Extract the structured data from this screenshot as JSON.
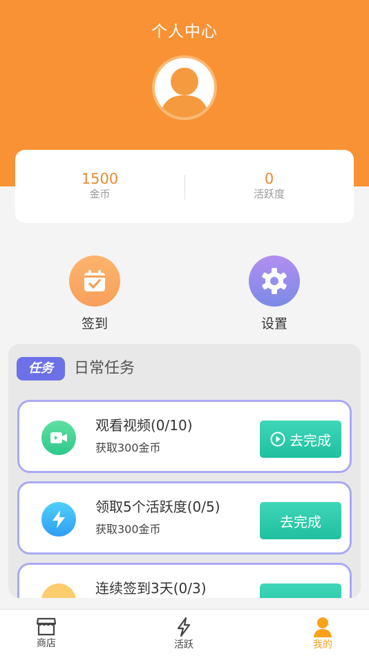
{
  "header": {
    "title": "个人中心"
  },
  "stats": [
    {
      "value": "1500",
      "label": "金币"
    },
    {
      "value": "0",
      "label": "活跃度"
    }
  ],
  "quick_actions": [
    {
      "label": "签到",
      "icon": "calendar-check-icon"
    },
    {
      "label": "设置",
      "icon": "gear-icon"
    }
  ],
  "tasks_panel": {
    "badge": "任务",
    "title": "日常任务",
    "tasks": [
      {
        "name": "观看视频(0/10)",
        "reward": "获取300金币",
        "button": "去完成",
        "icon": "video-icon"
      },
      {
        "name": "领取5个活跃度(0/5)",
        "reward": "获取300金币",
        "button": "去完成",
        "icon": "lightning-icon"
      },
      {
        "name": "连续签到3天(0/3)",
        "reward": "",
        "button": "",
        "icon": "task-icon"
      }
    ]
  },
  "tabbar": [
    {
      "label": "商店",
      "icon": "shop-icon"
    },
    {
      "label": "活跃",
      "icon": "lightning-icon"
    },
    {
      "label": "我的",
      "icon": "user-icon",
      "active": true
    }
  ],
  "colors": {
    "primary": "#f89234",
    "accent": "#6d71e8",
    "button": "#1fc0a0",
    "active_tab": "#f6a21b"
  }
}
